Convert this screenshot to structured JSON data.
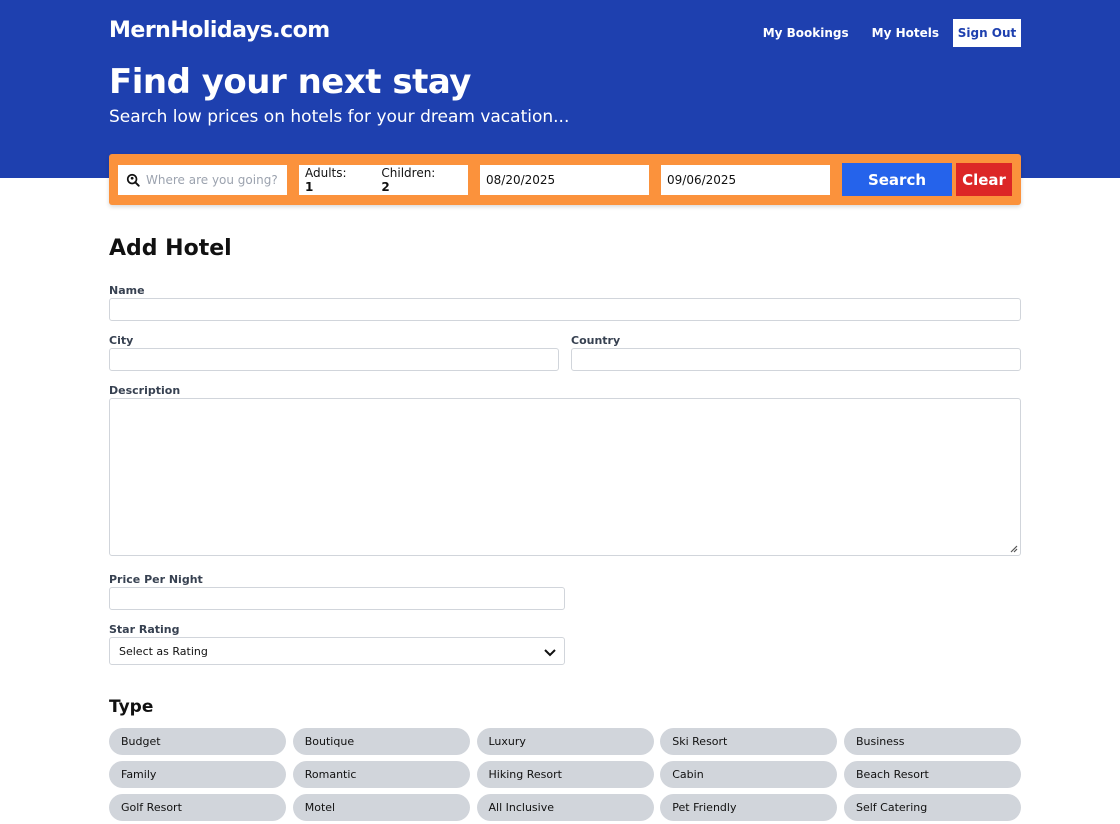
{
  "header": {
    "brand": "MernHolidays.com",
    "nav": [
      "My Bookings",
      "My Hotels"
    ],
    "sign_out": "Sign Out",
    "title": "Find your next stay",
    "subtitle": "Search low prices on hotels for your dream vacation..."
  },
  "search": {
    "destination_placeholder": "Where are you going?",
    "destination_icon": "location-search-icon",
    "adults_label": "Adults:",
    "adults_value": "1",
    "children_label": "Children:",
    "children_value": "2",
    "check_in": "08/20/2025",
    "check_out": "09/06/2025",
    "search_label": "Search",
    "clear_label": "Clear"
  },
  "form": {
    "title": "Add Hotel",
    "name_label": "Name",
    "city_label": "City",
    "country_label": "Country",
    "description_label": "Description",
    "price_label": "Price Per Night",
    "star_label": "Star Rating",
    "star_selected": "Select as Rating"
  },
  "types": {
    "title": "Type",
    "items": [
      "Budget",
      "Boutique",
      "Luxury",
      "Ski Resort",
      "Business",
      "Family",
      "Romantic",
      "Hiking Resort",
      "Cabin",
      "Beach Resort",
      "Golf Resort",
      "Motel",
      "All Inclusive",
      "Pet Friendly",
      "Self Catering"
    ]
  },
  "colors": {
    "header_bg": "#1e40af",
    "search_bar": "#fb923c",
    "search_button": "#2563eb",
    "clear_button": "#dc2626",
    "chip_bg": "#d1d5db"
  }
}
